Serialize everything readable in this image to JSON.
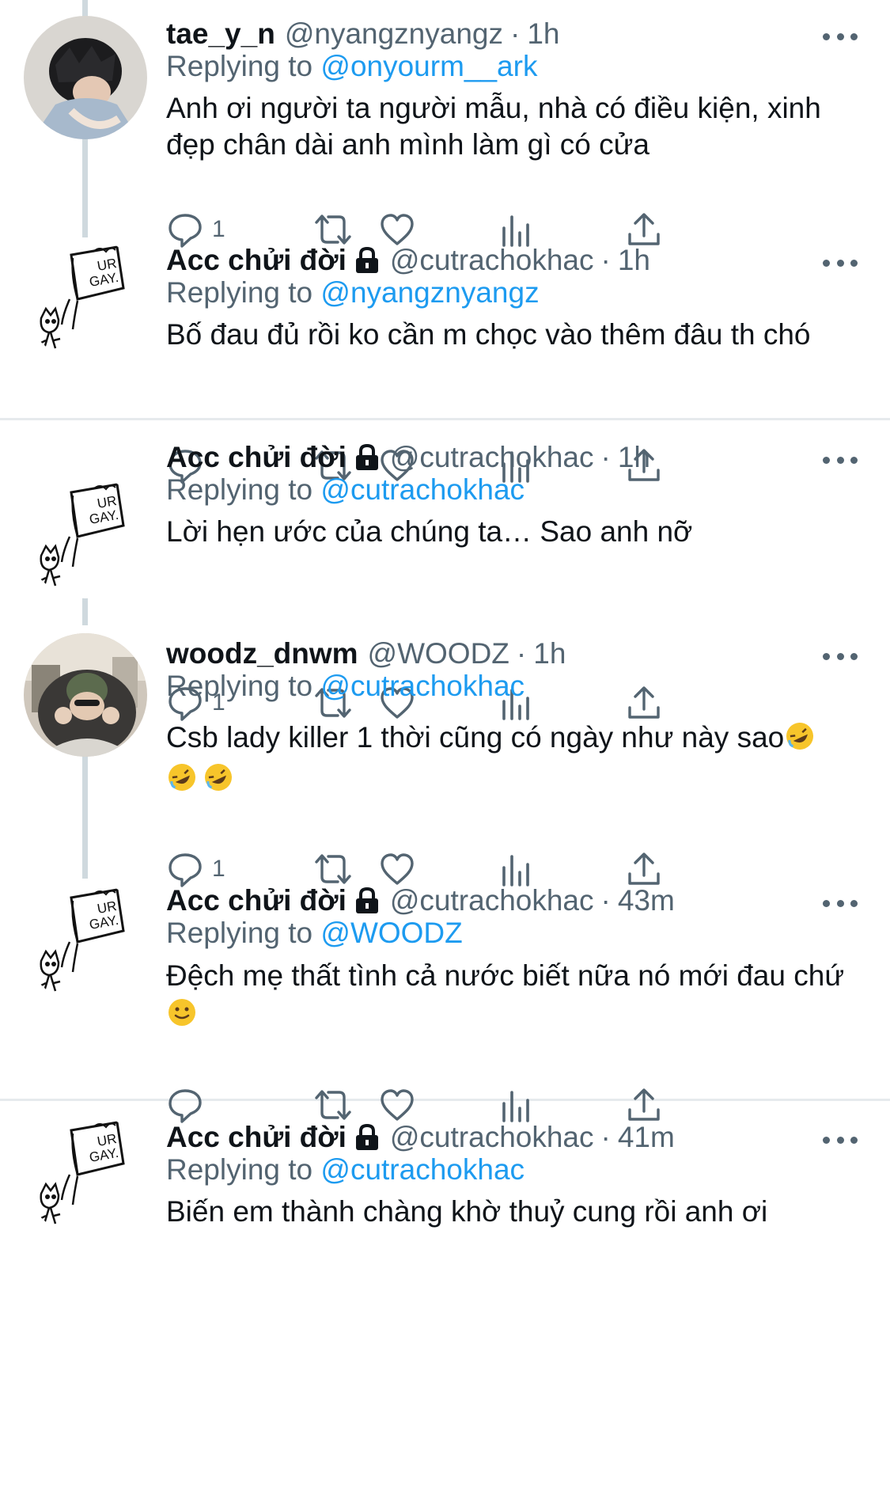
{
  "tweets": [
    {
      "name": "tae_y_n",
      "handle": "@nyangznyangz",
      "time": "1h",
      "locked": false,
      "replying_label": "Replying to",
      "replying_to": "@onyourm__ark",
      "text": "Anh ơi người ta người mẫu, nhà có điều kiện, xinh đẹp chân dài anh mình làm gì có cửa",
      "reply_count": "1",
      "avatar": "photo-avatar"
    },
    {
      "name": "Acc chửi đời",
      "handle": "@cutrachokhac",
      "time": "1h",
      "locked": true,
      "replying_label": "Replying to",
      "replying_to": "@nyangznyangz",
      "text": "Bố đau đủ rồi ko cần m chọc vào thêm đâu th chó",
      "reply_count": "",
      "avatar": "ur-gay-sketch-avatar"
    },
    {
      "name": "Acc chửi đời",
      "handle": "@cutrachokhac",
      "time": "1h",
      "locked": true,
      "replying_label": "Replying to",
      "replying_to": "@cutrachokhac",
      "text": "Lời hẹn ước của chúng ta… Sao anh nỡ",
      "reply_count": "1",
      "avatar": "ur-gay-sketch-avatar"
    },
    {
      "name": "woodz_dnwm",
      "handle": "@WOODZ",
      "time": "1h",
      "locked": false,
      "replying_label": "Replying to",
      "replying_to": "@cutrachokhac",
      "text": "Csb lady killer 1 thời cũng có ngày như này sao",
      "emojis": [
        "rofl-emoji",
        "rofl-emoji",
        "rofl-emoji"
      ],
      "reply_count": "1",
      "avatar": "photo-avatar"
    },
    {
      "name": "Acc chửi đời",
      "handle": "@cutrachokhac",
      "time": "43m",
      "locked": true,
      "replying_label": "Replying to",
      "replying_to": "@WOODZ",
      "text": "Đệch mẹ thất tình cả nước biết nữa nó mới đau chứ",
      "emojis": [
        "slight-smile-emoji"
      ],
      "reply_count": "",
      "avatar": "ur-gay-sketch-avatar"
    },
    {
      "name": "Acc chửi đời",
      "handle": "@cutrachokhac",
      "time": "41m",
      "locked": true,
      "replying_label": "Replying to",
      "replying_to": "@cutrachokhac",
      "text": "Biến em thành chàng khờ thuỷ cung rồi anh ơi",
      "reply_count": "",
      "avatar": "ur-gay-sketch-avatar"
    }
  ],
  "sketch_lettering": [
    "UR",
    "GAY."
  ],
  "colors": {
    "text": "#0f1419",
    "muted": "#536471",
    "link": "#1d9bf0",
    "thread_line": "#cfd9de",
    "divider": "#e6eaed"
  },
  "icons": [
    "reply-icon",
    "retweet-icon",
    "like-icon",
    "analytics-icon",
    "share-icon",
    "lock-icon",
    "more-icon"
  ]
}
